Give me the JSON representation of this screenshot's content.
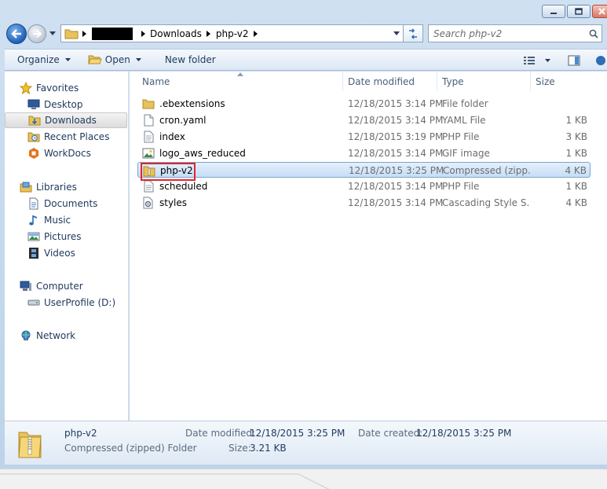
{
  "address": {
    "crumbs": [
      "Downloads",
      "php-v2"
    ]
  },
  "search": {
    "placeholder": "Search php-v2"
  },
  "commands": {
    "organize": "Organize",
    "open": "Open",
    "new_folder": "New folder"
  },
  "nav": {
    "favorites": {
      "label": "Favorites",
      "items": [
        "Desktop",
        "Downloads",
        "Recent Places",
        "WorkDocs"
      ]
    },
    "libraries": {
      "label": "Libraries",
      "items": [
        "Documents",
        "Music",
        "Pictures",
        "Videos"
      ]
    },
    "computer": {
      "label": "Computer",
      "items": [
        "UserProfile (D:)"
      ]
    },
    "network": {
      "label": "Network"
    },
    "selected": "Downloads"
  },
  "columns": {
    "name": "Name",
    "date": "Date modified",
    "type": "Type",
    "size": "Size"
  },
  "files": [
    {
      "name": ".ebextensions",
      "date": "12/18/2015 3:14 PM",
      "type": "File folder",
      "size": "",
      "icon": "folder-icon"
    },
    {
      "name": "cron.yaml",
      "date": "12/18/2015 3:14 PM",
      "type": "YAML File",
      "size": "1 KB",
      "icon": "file-icon"
    },
    {
      "name": "index",
      "date": "12/18/2015 3:19 PM",
      "type": "PHP File",
      "size": "3 KB",
      "icon": "text-file-icon"
    },
    {
      "name": "logo_aws_reduced",
      "date": "12/18/2015 3:14 PM",
      "type": "GIF image",
      "size": "1 KB",
      "icon": "image-file-icon"
    },
    {
      "name": "php-v2",
      "date": "12/18/2015 3:25 PM",
      "type": "Compressed (zipp...",
      "size": "4 KB",
      "icon": "zip-folder-icon",
      "selected": true
    },
    {
      "name": "scheduled",
      "date": "12/18/2015 3:14 PM",
      "type": "PHP File",
      "size": "1 KB",
      "icon": "text-file-icon"
    },
    {
      "name": "styles",
      "date": "12/18/2015 3:14 PM",
      "type": "Cascading Style S...",
      "size": "4 KB",
      "icon": "css-file-icon"
    }
  ],
  "details": {
    "name": "php-v2",
    "type": "Compressed (zipped) Folder",
    "date_modified_label": "Date modified:",
    "date_modified": "12/18/2015 3:25 PM",
    "size_label": "Size:",
    "size": "3.21 KB",
    "date_created_label": "Date created:",
    "date_created": "12/18/2015 3:25 PM"
  },
  "colors": {
    "accent": "#1f5fb8",
    "selection": "#c6def7",
    "highlight_box": "#e0262c"
  }
}
